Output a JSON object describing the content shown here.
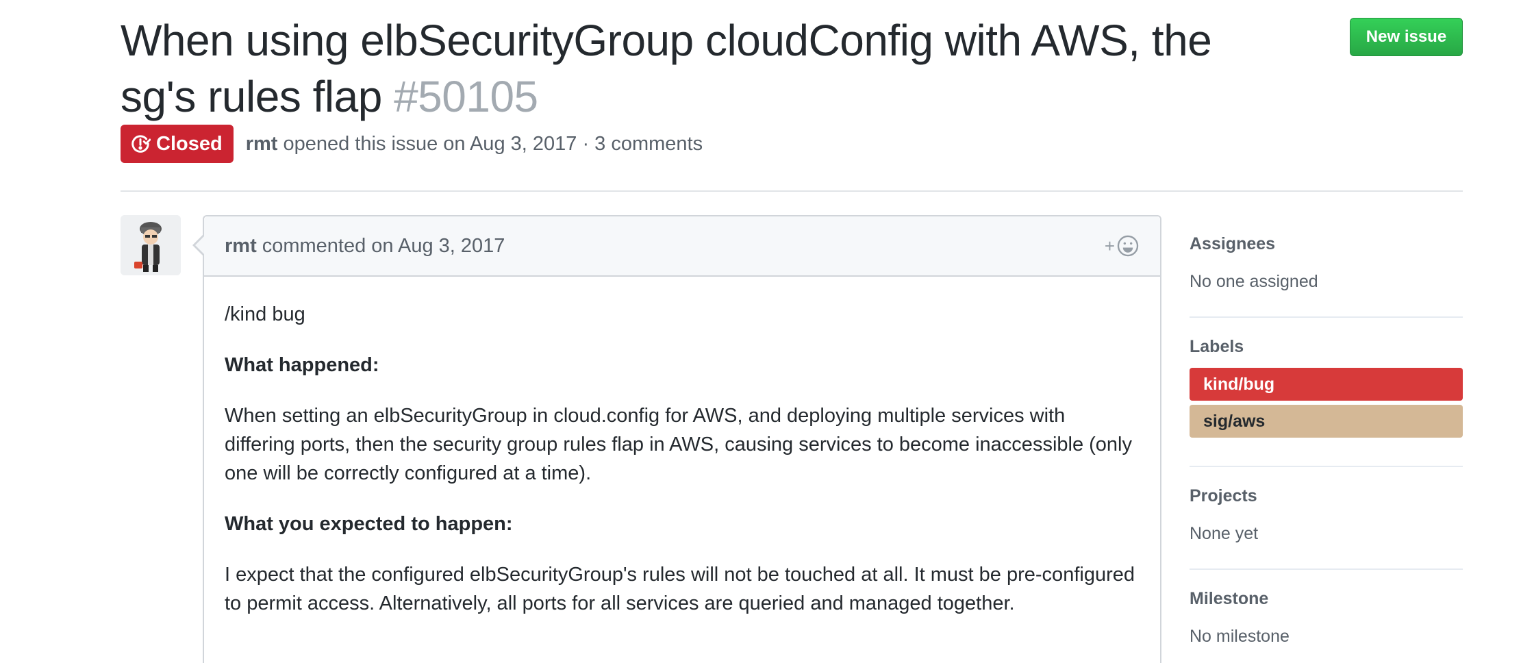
{
  "issue": {
    "title": "When using elbSecurityGroup cloudConfig with AWS, the sg's rules flap",
    "number": "#50105",
    "state": "Closed",
    "state_icon": "issue-closed-icon",
    "author": "rmt",
    "opened_text": "opened this issue on Aug 3, 2017 · 3 comments"
  },
  "header": {
    "new_issue_label": "New issue",
    "new_issue_color": "#28a745",
    "closed_color": "#cb2431"
  },
  "comment": {
    "author": "rmt",
    "action_text": "commented on Aug 3, 2017",
    "reaction_icon": "smiley-add-icon",
    "reaction_plus": "+",
    "body": {
      "line1": "/kind bug",
      "heading_happened": "What happened:",
      "text_happened": "When setting an elbSecurityGroup in cloud.config for AWS, and deploying multiple services with differing ports, then the security group rules flap in AWS, causing services to become inaccessible (only one will be correctly configured at a time).",
      "heading_expected": "What you expected to happen:",
      "text_expected": "I expect that the configured elbSecurityGroup's rules will not be touched at all. It must be pre-configured to permit access. Alternatively, all ports for all services are queried and managed together."
    }
  },
  "sidebar": {
    "assignees": {
      "heading": "Assignees",
      "value": "No one assigned"
    },
    "labels": {
      "heading": "Labels",
      "items": [
        {
          "name": "kind/bug",
          "color": "#d73a3a",
          "text_color": "#ffffff"
        },
        {
          "name": "sig/aws",
          "color": "#d4b896",
          "text_color": "#24292e"
        }
      ]
    },
    "projects": {
      "heading": "Projects",
      "value": "None yet"
    },
    "milestone": {
      "heading": "Milestone",
      "value": "No milestone"
    }
  }
}
